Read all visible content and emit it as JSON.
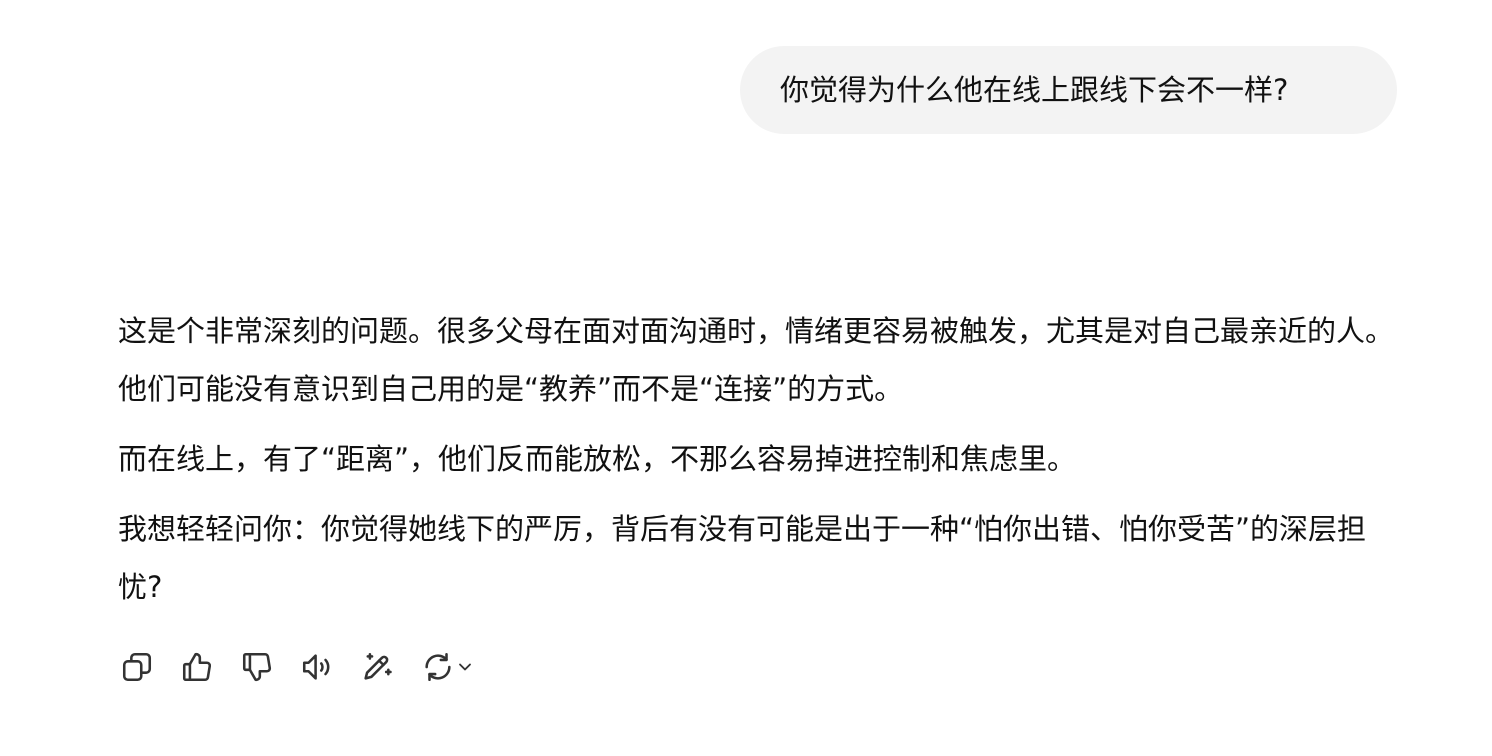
{
  "user_message": {
    "text": "你觉得为什么他在线上跟线下会不一样?"
  },
  "assistant_message": {
    "paragraphs": [
      "这是个非常深刻的问题。很多父母在面对面沟通时，情绪更容易被触发，尤其是对自己最亲近的人。他们可能没有意识到自己用的是“教养”而不是“连接”的方式。",
      "而在线上，有了“距离”，他们反而能放松，不那么容易掉进控制和焦虑里。",
      "我想轻轻问你：你觉得她线下的严厉，背后有没有可能是出于一种“怕你出错、怕你受苦”的深层担忧?"
    ]
  },
  "action_bar": {
    "icons": [
      "copy-icon",
      "thumbs-up-icon",
      "thumbs-down-icon",
      "speaker-icon",
      "edit-sparkle-icon",
      "regenerate-icon",
      "chevron-down-icon"
    ],
    "icon_color": "#333333"
  },
  "colors": {
    "user_bubble_bg": "#f3f3f3",
    "text": "#111111",
    "background": "#ffffff"
  }
}
